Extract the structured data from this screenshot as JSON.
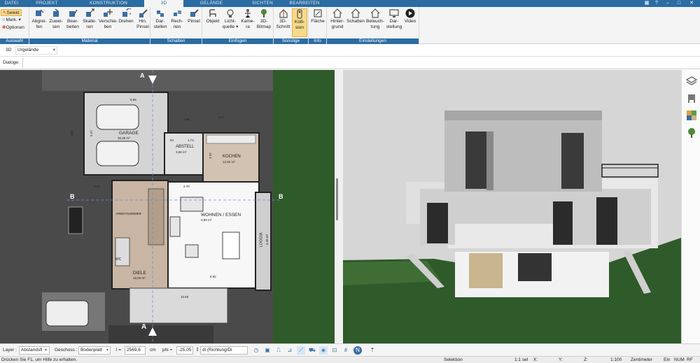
{
  "menu": {
    "tabs": [
      "DATEI",
      "PROJEKT",
      "KONSTRUKTION",
      "3D",
      "GELÄNDE",
      "SICHTEN",
      "BEARBEITEN"
    ],
    "active_tab": "3D"
  },
  "ribbon": {
    "auswahl": {
      "label": "Auswahl",
      "selekt": "Selekt",
      "mark": "Mark.",
      "optionen": "Optionen"
    },
    "material": {
      "label": "Material",
      "buttons": [
        "Abgrei-\nfen",
        "Zuwei-\nsen",
        "Bear-\nbeiten",
        "Skalie-\nren",
        "Verschie-\nben",
        "Drehen",
        "Hin.\nPinsel"
      ]
    },
    "schatten": {
      "label": "Schatten",
      "buttons": [
        "Dar-\nstellen",
        "Rech-\nnen",
        "Pinsel"
      ]
    },
    "einfuegen": {
      "label": "Einfügen",
      "buttons": [
        "Objekt",
        "Licht-\nquelle",
        "Kame-\nra",
        "3D-\nBitmap"
      ]
    },
    "sonstige": {
      "label": "Sonstige",
      "buttons": [
        "3D-\nSchnitt",
        "Kolli-\nsion"
      ]
    },
    "info": {
      "label": "Info",
      "buttons": [
        "Fläche"
      ]
    },
    "einstellungen": {
      "label": "Einstellungen",
      "buttons": [
        "Hinter-\ngrund",
        "Schatten",
        "Beleuch-\ntung",
        "Dar-\nstellung",
        "Video"
      ]
    }
  },
  "row3d": {
    "label": "3D",
    "value": "Urgelände"
  },
  "dialoge": {
    "label": "Dialoge:"
  },
  "plan": {
    "rooms": {
      "garage": "GARAGE",
      "garage_area": "36,38 m²",
      "abstell": "ABSTELL",
      "abstell_area": "3,68 m²",
      "kochen": "KOCHEN",
      "kochen_area": "12,92 m²",
      "wohnen": "WOHNEN / ESSEN",
      "wohnen_area": "0,89 m²",
      "loggia": "LOGGIA",
      "loggia_area": "4,40 m²",
      "diele": "DIELE",
      "diele_area": "18,00 m²",
      "arbeit": "ARBEITSZIMMER",
      "wc": "WC"
    },
    "dims": {
      "d1": "6.66",
      "d2": "5.97",
      "d3": "1.58",
      "d4": "2.76",
      "d5": "6.92",
      "d6": "2.00",
      "d7": "10.60",
      "d8": "8.82",
      "d9": "5.37",
      "d10": "2.37",
      "d11": "1.74",
      "d12": "84"
    },
    "markers": {
      "b": "B",
      "a": "A"
    }
  },
  "bottom": {
    "layer_label": "Layer :",
    "layer_value": "Abstandsfl",
    "geschoss_label": "Geschoss :",
    "geschoss_value": "Bodenplatt",
    "l_label": "l =",
    "l_value": "2569,6",
    "l_unit": "cm",
    "phi_label": "phi =",
    "phi_value": "-25,05",
    "dl_value": "dl (Richtung/Di"
  },
  "status": {
    "help": "Drücken Sie F1, um Hilfe zu erhalten.",
    "mode": "Selektion",
    "scale": "1:1 sel",
    "x": "X:",
    "y": "Y:",
    "z": "Z:",
    "ratio": "1:100",
    "unit": "Zentimeter",
    "ein": "Ein",
    "num": "NUM",
    "rf": "RF"
  },
  "colors": {
    "accent": "#2b6ca3",
    "active": "#f6d98a",
    "lawn": "#2f5a2a",
    "floor": "#e6e6e6",
    "plan_bg": "#4a4a4a"
  }
}
